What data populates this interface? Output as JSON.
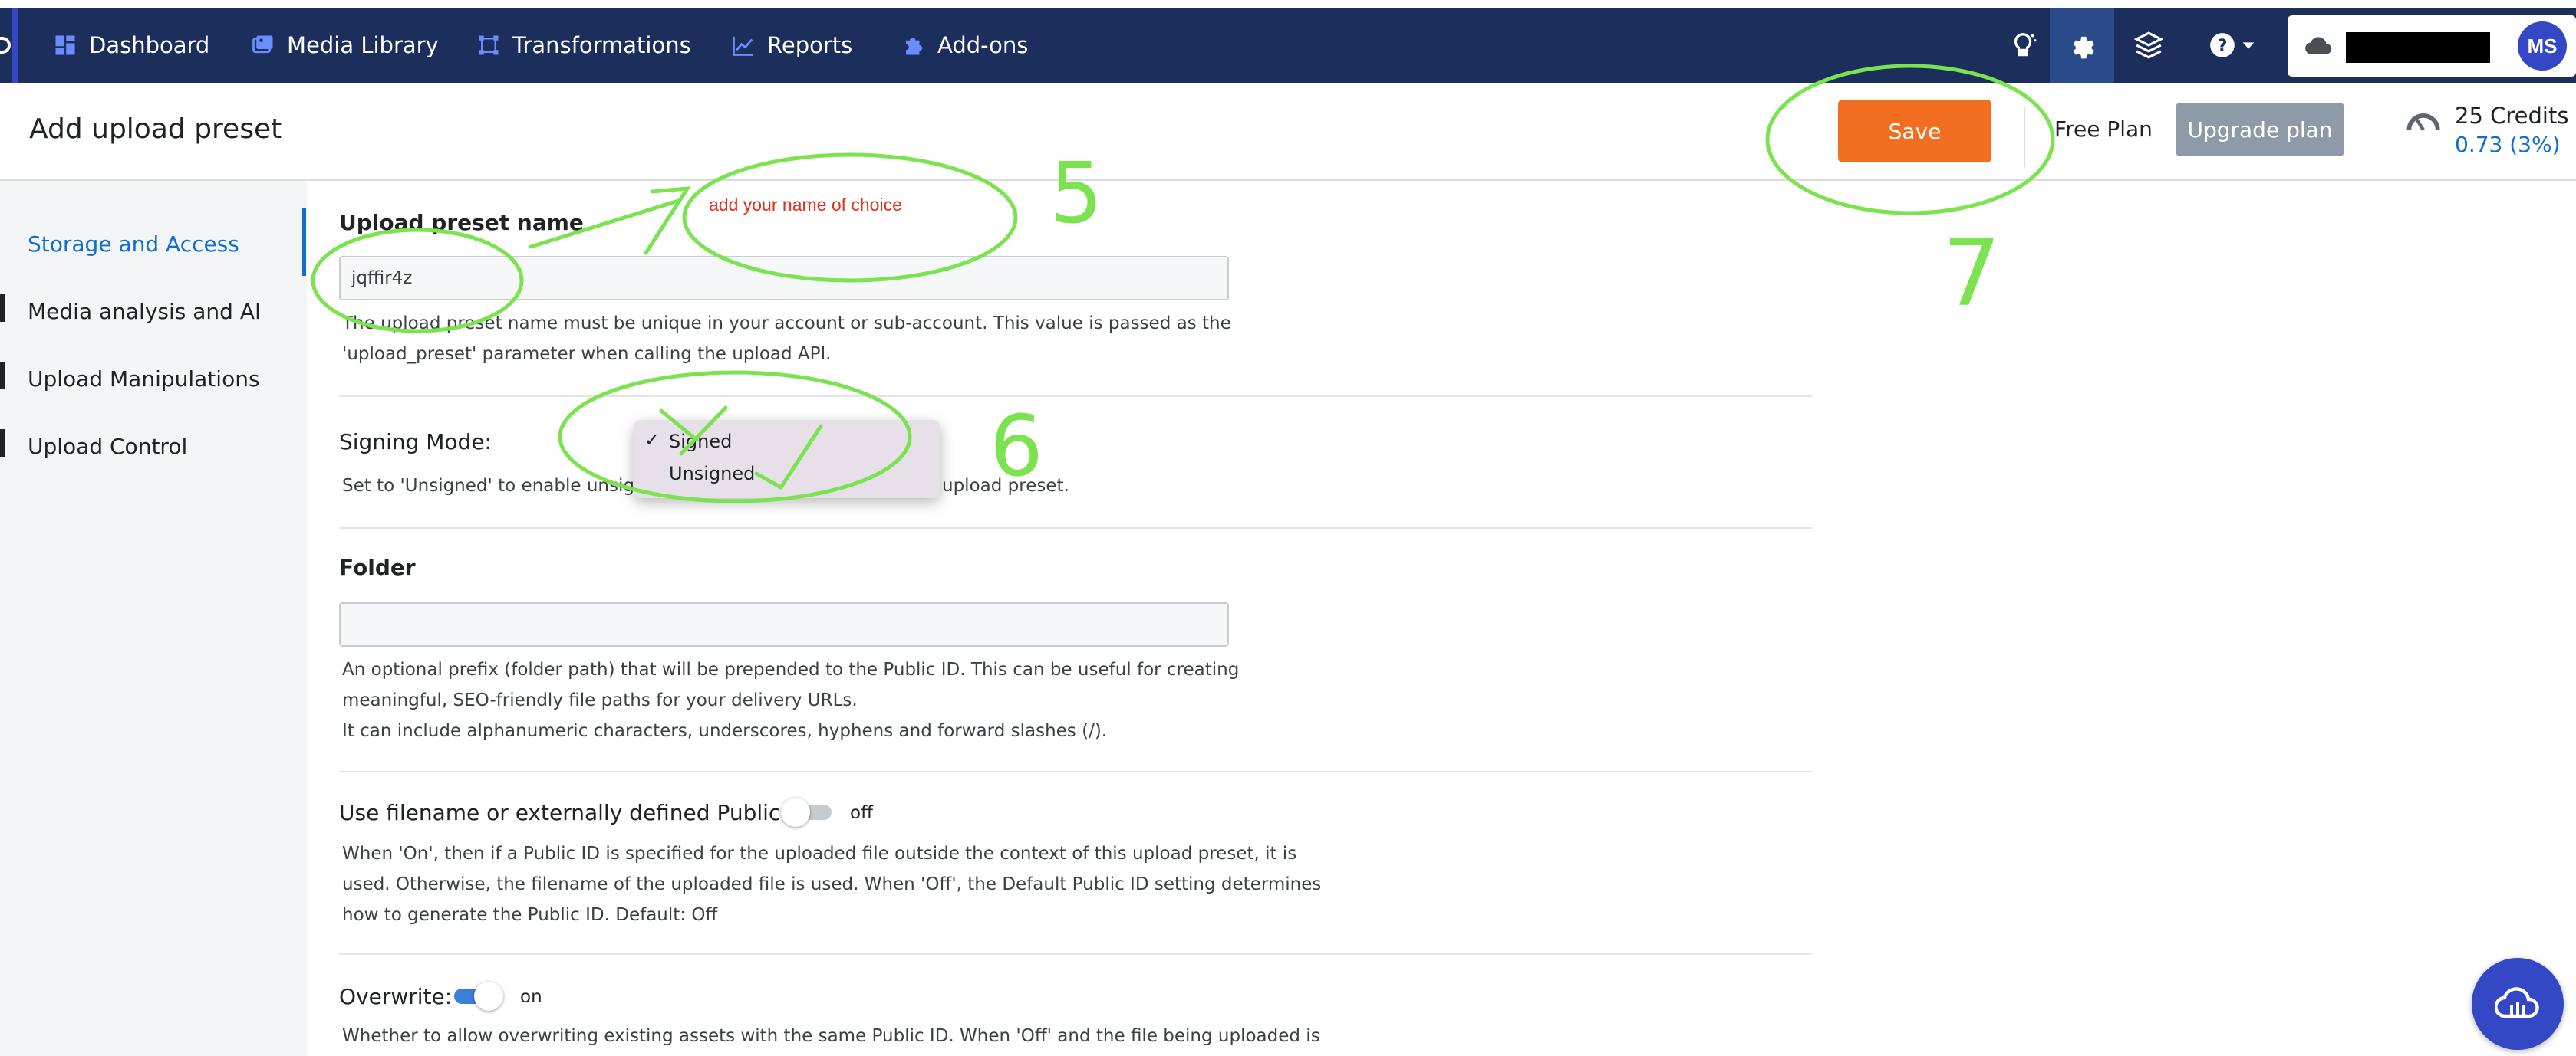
{
  "nav": {
    "items": [
      {
        "label": "Dashboard",
        "icon": "dashboard-icon"
      },
      {
        "label": "Media Library",
        "icon": "media-library-icon"
      },
      {
        "label": "Transformations",
        "icon": "transformations-icon"
      },
      {
        "label": "Reports",
        "icon": "reports-icon"
      },
      {
        "label": "Add-ons",
        "icon": "puzzle-icon"
      }
    ],
    "right_icons": [
      "lightbulb-icon",
      "gear-icon",
      "layers-icon",
      "help-icon",
      "chevron-down-icon",
      "cloud-icon"
    ],
    "avatar_initials": "MS"
  },
  "header": {
    "title": "Add upload preset",
    "save_label": "Save",
    "plan_label": "Free Plan",
    "upgrade_label": "Upgrade plan",
    "credits_label": "25 Credits",
    "credits_usage": "0.73 (3%)"
  },
  "sidebar": {
    "items": [
      {
        "label": "Storage and Access",
        "active": true
      },
      {
        "label": "Media analysis and AI",
        "active": false
      },
      {
        "label": "Upload Manipulations",
        "active": false
      },
      {
        "label": "Upload Control",
        "active": false
      }
    ]
  },
  "form": {
    "preset_name": {
      "label": "Upload preset name",
      "value": "jqffir4z",
      "help_line1": "The upload preset name must be unique in your account or sub-account. This value is passed as the",
      "help_line2": "'upload_preset' parameter when calling the upload API."
    },
    "signing_mode": {
      "label": "Signing Mode:",
      "help_left": "Set to 'Unsigned' to enable unsign",
      "help_right": "upload preset.",
      "options": [
        "Signed",
        "Unsigned"
      ],
      "selected": "Signed"
    },
    "folder": {
      "label": "Folder",
      "value": "",
      "help_line1": "An optional prefix (folder path) that will be prepended to the Public ID. This can be useful for creating",
      "help_line2": "meaningful, SEO-friendly file paths for your delivery URLs.",
      "help_line3": "It can include alphanumeric characters, underscores, hyphens and forward slashes (/)."
    },
    "use_filename": {
      "label": "Use filename or externally defined Public ID:",
      "state_text": "off",
      "on": false,
      "help_line1": "When 'On', then if a Public ID is specified for the uploaded file outside the context of this upload preset, it is",
      "help_line2": "used. Otherwise, the filename of the uploaded file is used. When 'Off', the Default Public ID setting determines",
      "help_line3": "how to generate the Public ID. Default: Off"
    },
    "overwrite": {
      "label": "Overwrite:",
      "state_text": "on",
      "on": true,
      "help_line1": "Whether to allow overwriting existing assets with the same Public ID. When 'Off' and the file being uploaded is"
    }
  },
  "annotations": {
    "note": "add your name of choice",
    "step5": "5",
    "step6": "6",
    "step7": "7"
  },
  "colors": {
    "nav_bg": "#1c2f5c",
    "accent_blue": "#0f6fcf",
    "save_orange": "#f26f21",
    "annotation_green": "#7be34f",
    "annotation_red": "#e0301e"
  }
}
